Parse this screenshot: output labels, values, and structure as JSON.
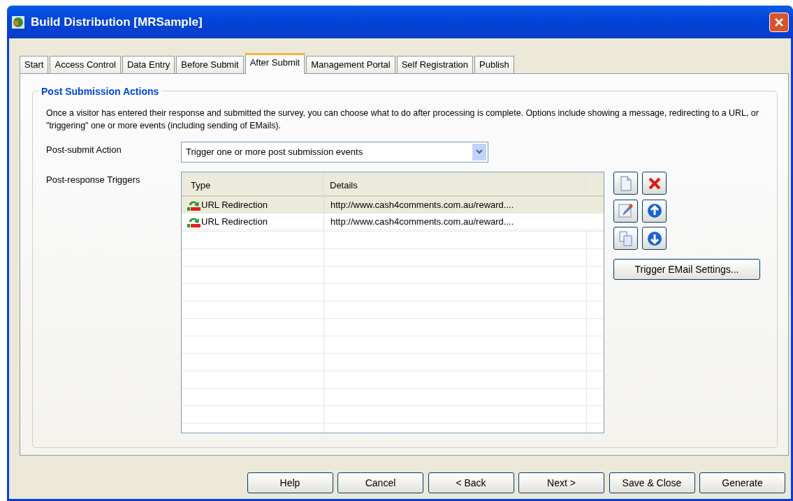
{
  "window": {
    "title": "Build Distribution [MRSample]"
  },
  "tabs": [
    {
      "label": "Start",
      "selected": false
    },
    {
      "label": "Access Control",
      "selected": false
    },
    {
      "label": "Data Entry",
      "selected": false
    },
    {
      "label": "Before Submit",
      "selected": false
    },
    {
      "label": "After Submit",
      "selected": true
    },
    {
      "label": "Management Portal",
      "selected": false
    },
    {
      "label": "Self Registration",
      "selected": false
    },
    {
      "label": "Publish",
      "selected": false
    }
  ],
  "group": {
    "title": "Post Submission Actions",
    "description": "Once a visitor has entered their response and submitted the survey, you can choose what to do after processing is complete. Options include showing a message, redirecting to a URL, or \"triggering\" one or more events (including sending of EMails)."
  },
  "action": {
    "label": "Post-submit Action",
    "value": "Trigger one or more post submission events"
  },
  "triggers": {
    "label": "Post-response Triggers",
    "columns": [
      "Type",
      "Details"
    ],
    "rows": [
      {
        "type": "URL Redirection",
        "details": "http://www.cash4comments.com.au/reward....",
        "selected": true
      },
      {
        "type": "URL Redirection",
        "details": "http://www.cash4comments.com.au/reward....",
        "selected": false
      }
    ]
  },
  "tools": [
    {
      "kind": "new"
    },
    {
      "kind": "delete"
    },
    {
      "kind": "edit"
    },
    {
      "kind": "up"
    },
    {
      "kind": "copy"
    },
    {
      "kind": "down"
    }
  ],
  "email_button": "Trigger EMail Settings...",
  "buttons": [
    "Help",
    "Cancel",
    "< Back",
    "Next >",
    "Save & Close",
    "Generate"
  ]
}
